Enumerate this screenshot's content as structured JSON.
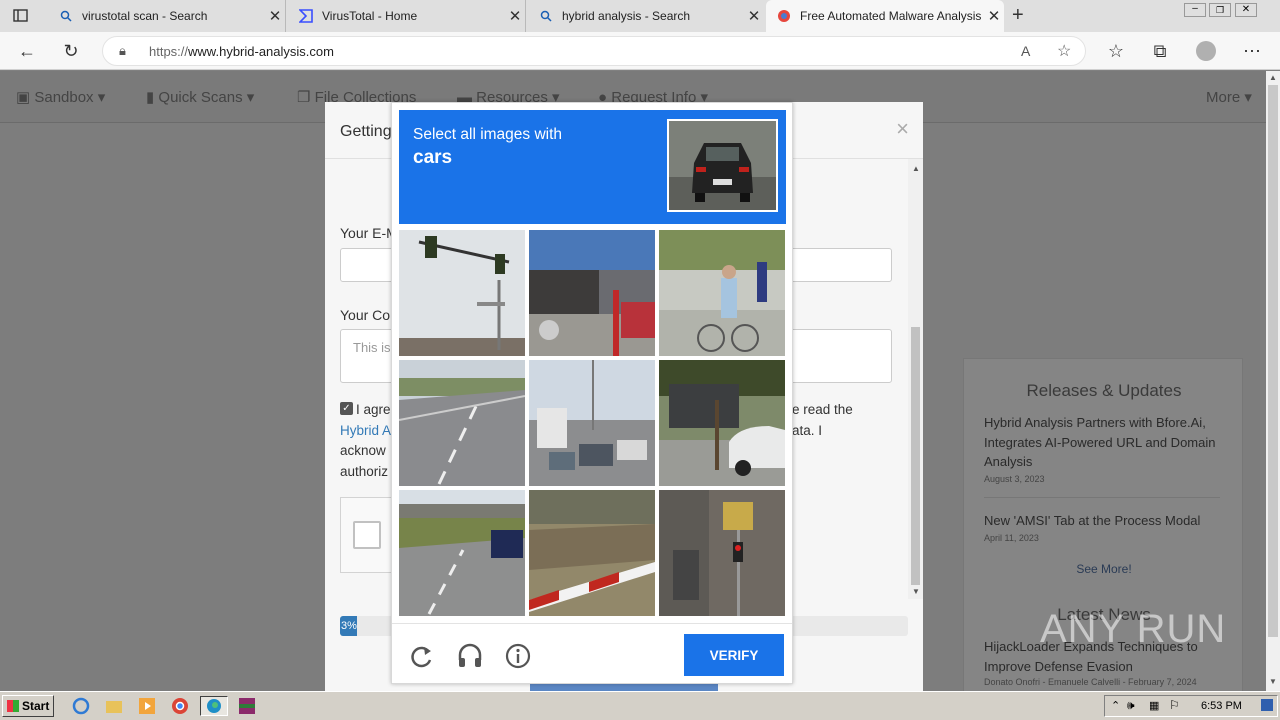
{
  "browser": {
    "tabs": [
      {
        "title": "virustotal scan - Search",
        "icon": "search-icon"
      },
      {
        "title": "VirusTotal - Home",
        "icon": "virustotal-icon"
      },
      {
        "title": "hybrid analysis - Search",
        "icon": "search-icon"
      },
      {
        "title": "Free Automated Malware Analysis",
        "icon": "hybrid-analysis-favicon",
        "active": true
      }
    ],
    "url_prefix": "https://",
    "url_host": "www.hybrid-analysis.com"
  },
  "site_nav": {
    "items": [
      "Sandbox",
      "Quick Scans",
      "File Collections",
      "Resources",
      "Request Info"
    ],
    "more": "More"
  },
  "modal": {
    "title": "Getting",
    "email_label": "Your E-M",
    "comment_label": "Your Co",
    "comment_placeholder": "This is",
    "agree_text_left": "I agree",
    "agree_text_right": "e read the",
    "link_left": "Hybrid A",
    "line2_right": "ata. I",
    "line3_left": "acknow",
    "line4_left": "authoriz",
    "progress_label": "3%",
    "progress_value": 0.03
  },
  "captcha": {
    "prompt": "Select all images with",
    "target": "cars",
    "verify_label": "VERIFY",
    "tiles": [
      "traffic-light",
      "market-street",
      "bicycle-rider",
      "empty-road",
      "traffic-jam",
      "parked-car",
      "highway-car",
      "bridge-curb",
      "building-traffic-light"
    ]
  },
  "news": {
    "releases_heading": "Releases & Updates",
    "item1_title": "Hybrid Analysis Partners with Bfore.Ai, Integrates AI-Powered URL and Domain Analysis",
    "item1_date": "August 3, 2023",
    "item2_title": "New 'AMSI' Tab at the Process Modal",
    "item2_date": "April 11, 2023",
    "see_more": "See More!",
    "latest_heading": "Latest News",
    "item3_title": "HijackLoader Expands Techniques to Improve Defense Evasion",
    "item3_meta": "Donato Onofri - Emanuele Calvelli - February 7, 2024"
  },
  "taskbar": {
    "start": "Start",
    "clock": "6:53 PM"
  },
  "watermark": "ANY RUN",
  "colors": {
    "captcha_blue": "#1a73e8",
    "link_blue": "#337ab7"
  }
}
